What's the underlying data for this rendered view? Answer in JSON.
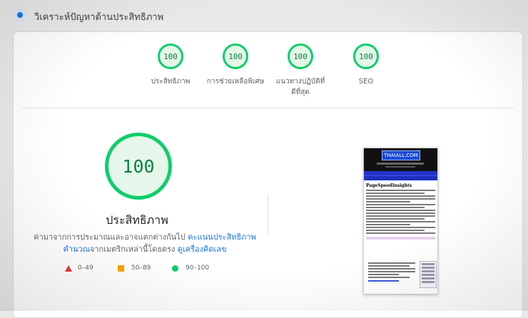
{
  "header": {
    "title": "วิเคราะห์ปัญหาด้านประสิทธิภาพ"
  },
  "gauges": [
    {
      "score": "100",
      "label": "ประสิทธิภาพ"
    },
    {
      "score": "100",
      "label": "การช่วยเหลือพิเศษ"
    },
    {
      "score": "100",
      "label": "แนวทางปฏิบัติที่ดีที่สุด"
    },
    {
      "score": "100",
      "label": "SEO"
    }
  ],
  "main": {
    "score": "100",
    "title": "ประสิทธิภาพ",
    "desc_prefix": "ค่ามาจากการประมาณและอาจแตกต่างกันไป ",
    "link_calc": "คะแนนประสิทธิภาพคำนวณ",
    "desc_mid": "จากเมตริกเหล่านี้โดยตรง ",
    "link_calculator": "ดูเครื่องคิดเลข"
  },
  "legend": [
    {
      "range": "0–49",
      "color": "#e53935"
    },
    {
      "range": "50–89",
      "color": "#ffa400"
    },
    {
      "range": "90–100",
      "color": "#0cce6b"
    }
  ],
  "thumbnail": {
    "logo": "THAIALL.COM",
    "heading": "PageSpeedInsights"
  },
  "colors": {
    "good": "#0cce6b",
    "link": "#1a73e8"
  }
}
